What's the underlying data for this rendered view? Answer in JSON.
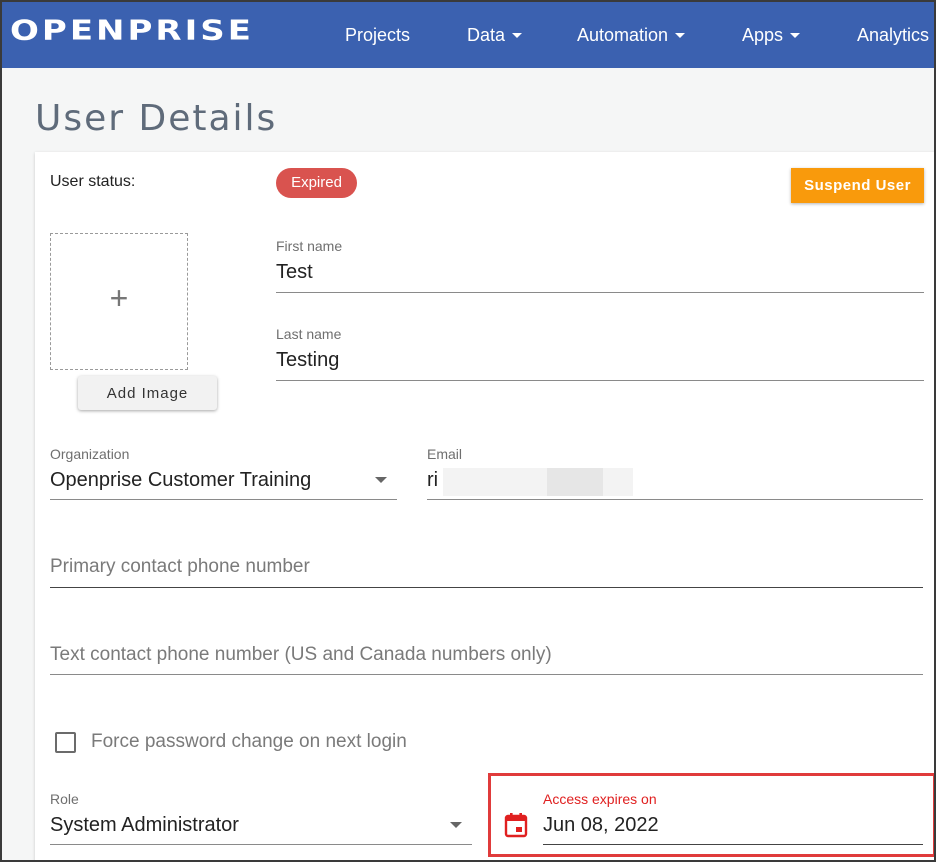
{
  "navbar": {
    "logo": "OPENPRISE",
    "items": [
      {
        "label": "Projects",
        "dropdown": false
      },
      {
        "label": "Data",
        "dropdown": true
      },
      {
        "label": "Automation",
        "dropdown": true
      },
      {
        "label": "Apps",
        "dropdown": true
      },
      {
        "label": "Analytics",
        "dropdown": false
      }
    ]
  },
  "page": {
    "title": "User Details"
  },
  "user": {
    "status_label": "User status:",
    "status_badge": "Expired",
    "suspend_button": "Suspend User",
    "add_image_button": "Add Image",
    "first_name": {
      "label": "First name",
      "value": "Test"
    },
    "last_name": {
      "label": "Last name",
      "value": "Testing"
    },
    "organization": {
      "label": "Organization",
      "value": "Openprise Customer Training"
    },
    "email": {
      "label": "Email",
      "value": "ri"
    },
    "primary_phone": {
      "placeholder": "Primary contact phone number"
    },
    "text_phone": {
      "placeholder": "Text contact phone number (US and Canada numbers only)"
    },
    "force_password": {
      "label": "Force password change on next login",
      "checked": false
    },
    "role": {
      "label": "Role",
      "value": "System Administrator"
    },
    "access_expires": {
      "label": "Access expires on",
      "value": "Jun 08, 2022"
    }
  },
  "colors": {
    "navbar": "#3b61b0",
    "expired_badge": "#d9534f",
    "suspend_button": "#f99a0c",
    "highlight": "#e03b3b"
  },
  "icons": {
    "image_placeholder": "plus-icon",
    "date": "calendar-icon"
  }
}
